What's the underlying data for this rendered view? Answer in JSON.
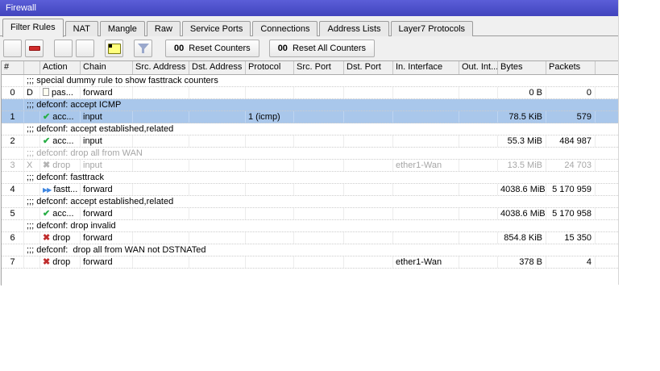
{
  "window": {
    "title": "Firewall"
  },
  "tabs": [
    {
      "label": "Filter Rules",
      "active": true
    },
    {
      "label": "NAT",
      "active": false
    },
    {
      "label": "Mangle",
      "active": false
    },
    {
      "label": "Raw",
      "active": false
    },
    {
      "label": "Service Ports",
      "active": false
    },
    {
      "label": "Connections",
      "active": false
    },
    {
      "label": "Address Lists",
      "active": false
    },
    {
      "label": "Layer7 Protocols",
      "active": false
    }
  ],
  "toolbar": {
    "icon_buttons": [
      {
        "name": "add-button",
        "icon": "plus-icon",
        "type": "plus",
        "gap": false
      },
      {
        "name": "remove-button",
        "icon": "minus-icon",
        "type": "minus",
        "gap": false
      },
      {
        "name": "enable-button",
        "icon": "check-icon",
        "type": "check",
        "gap": true
      },
      {
        "name": "disable-button",
        "icon": "cross-icon",
        "type": "cross",
        "gap": false
      },
      {
        "name": "comment-button",
        "icon": "note-icon",
        "type": "note",
        "gap": true
      },
      {
        "name": "filter-button",
        "icon": "funnel-icon",
        "type": "funnel",
        "gap": true
      }
    ],
    "reset_buttons": [
      {
        "name": "reset-counters-button",
        "prefix": "00",
        "label": "Reset Counters"
      },
      {
        "name": "reset-all-counters-button",
        "prefix": "00",
        "label": "Reset All Counters"
      }
    ]
  },
  "table": {
    "columns": [
      "#",
      "",
      "Action",
      "Chain",
      "Src. Address",
      "Dst. Address",
      "Protocol",
      "Src. Port",
      "Dst. Port",
      "In. Interface",
      "Out. Int...",
      "Bytes",
      "Packets",
      ""
    ],
    "rows": [
      {
        "type": "comment",
        "text": ";;; special dummy rule to show fasttrack counters",
        "selected": false,
        "disabled": false
      },
      {
        "type": "rule",
        "num": "0",
        "flag": "D",
        "action": "pas...",
        "action_icon": "passthrough",
        "chain": "forward",
        "src_address": "",
        "dst_address": "",
        "protocol": "",
        "src_port": "",
        "dst_port": "",
        "in_interface": "",
        "out_interface": "",
        "bytes": "0 B",
        "packets": "0",
        "selected": false,
        "disabled": false
      },
      {
        "type": "comment",
        "text": ";;; defconf: accept ICMP",
        "selected": true,
        "disabled": false
      },
      {
        "type": "rule",
        "num": "1",
        "flag": "",
        "action": "acc...",
        "action_icon": "accept",
        "chain": "input",
        "src_address": "",
        "dst_address": "",
        "protocol": "1 (icmp)",
        "src_port": "",
        "dst_port": "",
        "in_interface": "",
        "out_interface": "",
        "bytes": "78.5 KiB",
        "packets": "579",
        "selected": true,
        "disabled": false
      },
      {
        "type": "comment",
        "text": ";;; defconf: accept established,related",
        "selected": false,
        "disabled": false
      },
      {
        "type": "rule",
        "num": "2",
        "flag": "",
        "action": "acc...",
        "action_icon": "accept",
        "chain": "input",
        "src_address": "",
        "dst_address": "",
        "protocol": "",
        "src_port": "",
        "dst_port": "",
        "in_interface": "",
        "out_interface": "",
        "bytes": "55.3 MiB",
        "packets": "484 987",
        "selected": false,
        "disabled": false
      },
      {
        "type": "comment",
        "text": ";;; defconf: drop all from WAN",
        "selected": false,
        "disabled": true
      },
      {
        "type": "rule",
        "num": "3",
        "flag": "X",
        "action": "drop",
        "action_icon": "drop",
        "chain": "input",
        "src_address": "",
        "dst_address": "",
        "protocol": "",
        "src_port": "",
        "dst_port": "",
        "in_interface": "ether1-Wan",
        "out_interface": "",
        "bytes": "13.5 MiB",
        "packets": "24 703",
        "selected": false,
        "disabled": true
      },
      {
        "type": "comment",
        "text": ";;; defconf: fasttrack",
        "selected": false,
        "disabled": false
      },
      {
        "type": "rule",
        "num": "4",
        "flag": "",
        "action": "fastt...",
        "action_icon": "fasttrack",
        "chain": "forward",
        "src_address": "",
        "dst_address": "",
        "protocol": "",
        "src_port": "",
        "dst_port": "",
        "in_interface": "",
        "out_interface": "",
        "bytes": "4038.6 MiB",
        "packets": "5 170 959",
        "selected": false,
        "disabled": false
      },
      {
        "type": "comment",
        "text": ";;; defconf: accept established,related",
        "selected": false,
        "disabled": false
      },
      {
        "type": "rule",
        "num": "5",
        "flag": "",
        "action": "acc...",
        "action_icon": "accept",
        "chain": "forward",
        "src_address": "",
        "dst_address": "",
        "protocol": "",
        "src_port": "",
        "dst_port": "",
        "in_interface": "",
        "out_interface": "",
        "bytes": "4038.6 MiB",
        "packets": "5 170 958",
        "selected": false,
        "disabled": false
      },
      {
        "type": "comment",
        "text": ";;; defconf: drop invalid",
        "selected": false,
        "disabled": false
      },
      {
        "type": "rule",
        "num": "6",
        "flag": "",
        "action": "drop",
        "action_icon": "drop",
        "chain": "forward",
        "src_address": "",
        "dst_address": "",
        "protocol": "",
        "src_port": "",
        "dst_port": "",
        "in_interface": "",
        "out_interface": "",
        "bytes": "854.8 KiB",
        "packets": "15 350",
        "selected": false,
        "disabled": false
      },
      {
        "type": "comment",
        "text": ";;; defconf:  drop all from WAN not DSTNATed",
        "selected": false,
        "disabled": false
      },
      {
        "type": "rule",
        "num": "7",
        "flag": "",
        "action": "drop",
        "action_icon": "drop",
        "chain": "forward",
        "src_address": "",
        "dst_address": "",
        "protocol": "",
        "src_port": "",
        "dst_port": "",
        "in_interface": "ether1-Wan",
        "out_interface": "",
        "bytes": "378 B",
        "packets": "4",
        "selected": false,
        "disabled": false
      }
    ]
  },
  "colors": {
    "titlebar_blue": "#4a4dc5",
    "selection_blue": "#a9c7eb",
    "accept_green": "#27ae45",
    "drop_red": "#bf2c2c",
    "fasttrack_blue": "#3f86e0",
    "disabled_gray": "#a6a6a6"
  }
}
